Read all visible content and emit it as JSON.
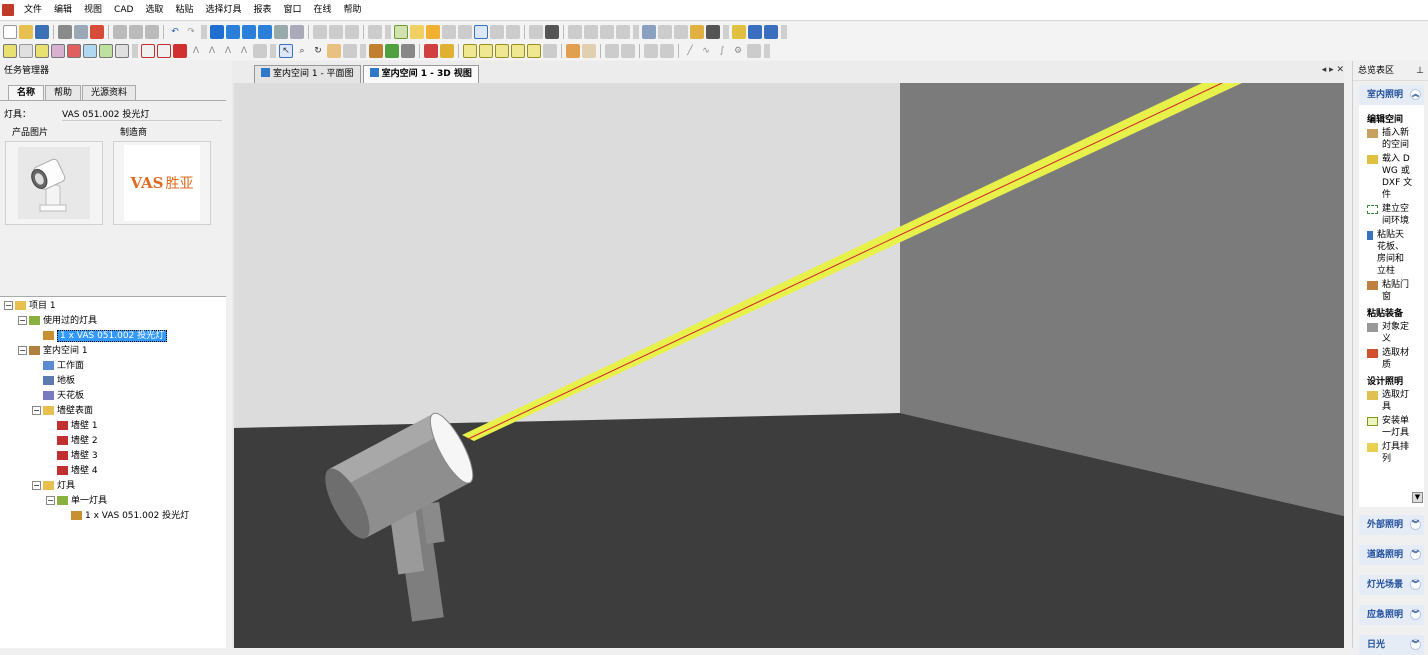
{
  "menu": [
    "文件",
    "编辑",
    "视图",
    "CAD",
    "选取",
    "粘贴",
    "选择灯具",
    "报表",
    "窗口",
    "在线",
    "帮助"
  ],
  "task_manager": {
    "title": "任务管理器",
    "tabs": [
      "名称",
      "帮助",
      "光源资料"
    ],
    "lamp_label": "灯具：",
    "lamp_value": "VAS 051.002 投光灯",
    "product_image_label": "产品图片",
    "manufacturer_label": "制造商",
    "manufacturer_logo_text": "VAS",
    "manufacturer_logo_cn": "胜亚"
  },
  "tree": [
    {
      "label": "项目 1",
      "level": 0,
      "icon": "folder-icon",
      "expand": "−"
    },
    {
      "label": "使用过的灯具",
      "level": 1,
      "icon": "luminaire-group-icon",
      "expand": "−"
    },
    {
      "label": "1 x VAS 051.002 投光灯",
      "level": 2,
      "icon": "luminaire-icon",
      "selected": true
    },
    {
      "label": "室内空间 1",
      "level": 1,
      "icon": "room-icon",
      "expand": "−"
    },
    {
      "label": "工作面",
      "level": 2,
      "icon": "workplane-icon"
    },
    {
      "label": "地板",
      "level": 2,
      "icon": "floor-icon"
    },
    {
      "label": "天花板",
      "level": 2,
      "icon": "ceiling-icon"
    },
    {
      "label": "墙壁表面",
      "level": 2,
      "icon": "folder-icon",
      "expand": "−"
    },
    {
      "label": "墙壁 1",
      "level": 3,
      "icon": "wall-icon"
    },
    {
      "label": "墙壁 2",
      "level": 3,
      "icon": "wall-icon"
    },
    {
      "label": "墙壁 3",
      "level": 3,
      "icon": "wall-icon"
    },
    {
      "label": "墙壁 4",
      "level": 3,
      "icon": "wall-icon"
    },
    {
      "label": "灯具",
      "level": 2,
      "icon": "folder-icon",
      "expand": "−"
    },
    {
      "label": "单一灯具",
      "level": 3,
      "icon": "luminaire-group-icon",
      "expand": "−"
    },
    {
      "label": "1 x VAS 051.002 投光灯",
      "level": 4,
      "icon": "luminaire-icon"
    }
  ],
  "doc_tabs": [
    {
      "label": "室内空间 1 - 平面图",
      "active": false
    },
    {
      "label": "室内空间 1 - 3D 视图",
      "active": true
    }
  ],
  "nav_controls": "◂ ▸ ✕",
  "overview": {
    "title": "总览表区",
    "pin": "ᵖ",
    "sections": [
      {
        "title": "室内照明",
        "expanded": true,
        "groups": [
          {
            "title": "编辑空间",
            "tasks": [
              "插入新的空间",
              "载入 DWG 或 DXF 文件",
              "建立空间环境",
              "粘贴天花板、房间和立柱",
              "粘贴门窗"
            ]
          },
          {
            "title": "粘贴装备",
            "tasks": [
              "对象定义",
              "选取材质"
            ]
          },
          {
            "title": "设计照明",
            "tasks": [
              "选取灯具",
              "安装单一灯具",
              "灯具排列"
            ]
          }
        ]
      },
      {
        "title": "外部照明",
        "expanded": false
      },
      {
        "title": "道路照明",
        "expanded": false
      },
      {
        "title": "灯光场景",
        "expanded": false
      },
      {
        "title": "应急照明",
        "expanded": false
      },
      {
        "title": "日光",
        "expanded": false
      }
    ]
  },
  "colors": {
    "accent_blue": "#1f4e9b",
    "selection": "#3399ff",
    "beam": "#e8f04a",
    "beam_axis": "#d0202a",
    "floor": "#3d3d3d",
    "back_wall": "#dcdcdc",
    "right_wall": "#7a7a7a",
    "brand_orange": "#e06a1e"
  }
}
